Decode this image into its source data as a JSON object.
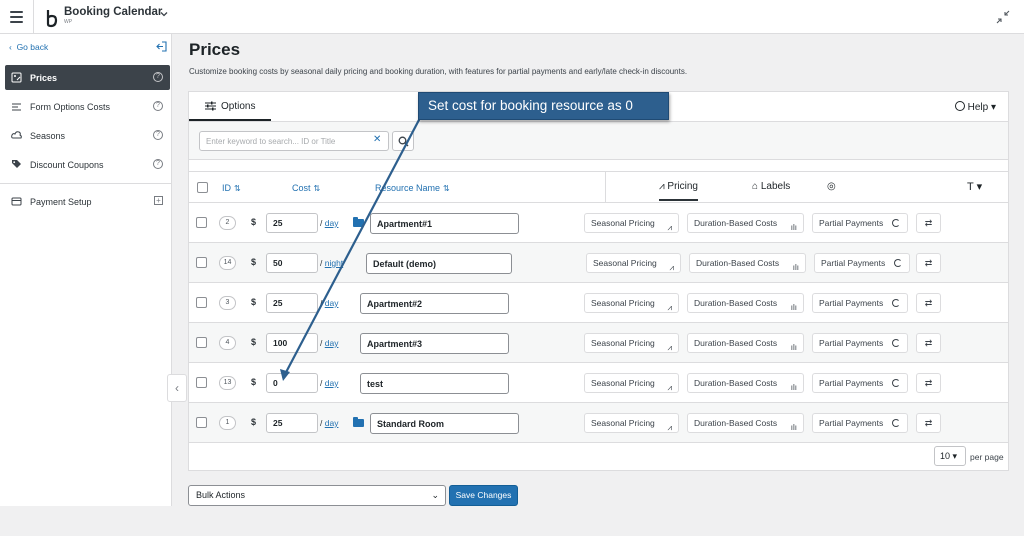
{
  "app": {
    "brand": "Booking Calendar",
    "brand_sub": "WP"
  },
  "sidebar": {
    "goback_label": "Go back",
    "items": [
      {
        "label": "Prices",
        "icon": "prices-icon",
        "active": true
      },
      {
        "label": "Form Options Costs",
        "icon": "form-options-icon",
        "active": false
      },
      {
        "label": "Seasons",
        "icon": "seasons-icon",
        "active": false
      },
      {
        "label": "Discount Coupons",
        "icon": "coupon-icon",
        "active": false
      }
    ],
    "payment_setup_label": "Payment Setup",
    "help_glyph": "?",
    "plus_glyph": "+"
  },
  "page": {
    "title": "Prices",
    "description": "Customize booking costs by seasonal daily pricing and booking duration, with features for partial payments and early/late check-in discounts."
  },
  "tabs": {
    "options_label": "Options",
    "help_label": "Help"
  },
  "search": {
    "placeholder": "Enter keyword to search... ID or Title",
    "value": ""
  },
  "table": {
    "columns": {
      "id": "ID",
      "cost": "Cost",
      "resource_name": "Resource Name"
    },
    "subtabs": {
      "pricing": "Pricing",
      "labels": "Labels"
    },
    "buttons": {
      "seasonal": "Seasonal Pricing",
      "duration": "Duration-Based Costs",
      "partial": "Partial Payments"
    },
    "rows": [
      {
        "id": "2",
        "cost": "25",
        "period": "day",
        "name": "Apartment#1",
        "folder": true
      },
      {
        "id": "14",
        "cost": "50",
        "period": "night",
        "name": "Default (demo)",
        "folder": false
      },
      {
        "id": "3",
        "cost": "25",
        "period": "day",
        "name": "Apartment#2",
        "folder": false
      },
      {
        "id": "4",
        "cost": "100",
        "period": "day",
        "name": "Apartment#3",
        "folder": false
      },
      {
        "id": "13",
        "cost": "0",
        "period": "day",
        "name": "test",
        "folder": false
      },
      {
        "id": "1",
        "cost": "25",
        "period": "day",
        "name": "Standard Room",
        "folder": true
      }
    ],
    "currency": "$"
  },
  "pagination": {
    "per_page_value": "10",
    "per_page_label": "per page"
  },
  "footer": {
    "bulk_actions_label": "Bulk Actions",
    "save_label": "Save Changes"
  },
  "annotation": {
    "text": "Set  cost  for booking resource  as 0"
  },
  "colors": {
    "accent": "#2271b1",
    "sidebar_active": "#3c434a",
    "callout": "#2d5f8e"
  }
}
